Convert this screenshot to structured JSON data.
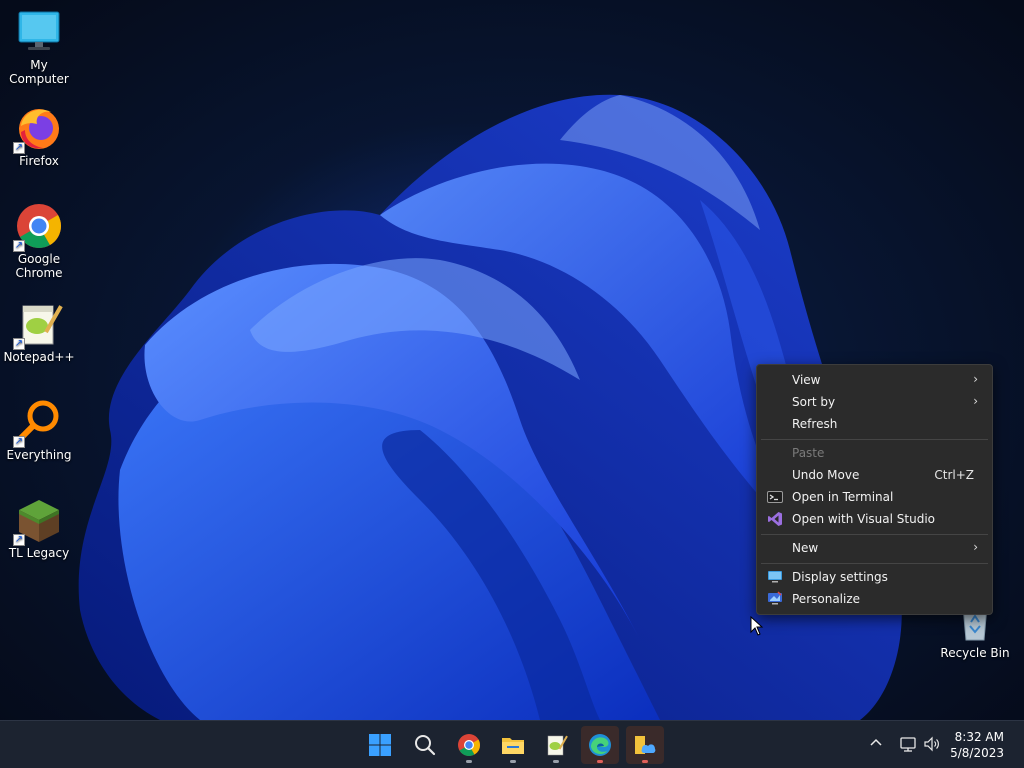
{
  "desktop": {
    "icons": [
      {
        "label": "My Computer",
        "icon": "monitor-icon"
      },
      {
        "label": "Firefox",
        "icon": "firefox-icon"
      },
      {
        "label": "Google Chrome",
        "icon": "chrome-icon"
      },
      {
        "label": "Notepad++",
        "icon": "notepadpp-icon"
      },
      {
        "label": "Everything",
        "icon": "everything-search-icon"
      },
      {
        "label": "TL Legacy",
        "icon": "minecraft-grass-block-icon"
      },
      {
        "label": "Recycle Bin",
        "icon": "recycle-bin-icon"
      }
    ]
  },
  "context_menu": {
    "items": [
      {
        "label": "View",
        "submenu": true
      },
      {
        "label": "Sort by",
        "submenu": true
      },
      {
        "label": "Refresh"
      },
      {
        "label": "Paste",
        "disabled": true
      },
      {
        "label": "Undo Move",
        "accelerator": "Ctrl+Z"
      },
      {
        "label": "Open in Terminal",
        "icon": "terminal-icon"
      },
      {
        "label": "Open with Visual Studio",
        "icon": "visual-studio-icon"
      },
      {
        "label": "New",
        "submenu": true
      },
      {
        "label": "Display settings",
        "icon": "display-settings-icon"
      },
      {
        "label": "Personalize",
        "icon": "personalize-icon"
      }
    ],
    "chevron": "›"
  },
  "taskbar": {
    "apps": [
      "start-icon",
      "search-icon",
      "chrome-icon",
      "file-explorer-icon",
      "notepadpp-icon",
      "edge-icon",
      "onedrive-folder-icon"
    ],
    "tray": [
      "chevron-up-icon",
      "network-icon",
      "volume-icon"
    ]
  },
  "clock": {
    "time": "8:32 AM",
    "date": "5/8/2023"
  },
  "colors": {
    "accent": "#1a5cff",
    "menu_bg": "#2b2b2b",
    "taskbar_bg": "#1c2330"
  }
}
